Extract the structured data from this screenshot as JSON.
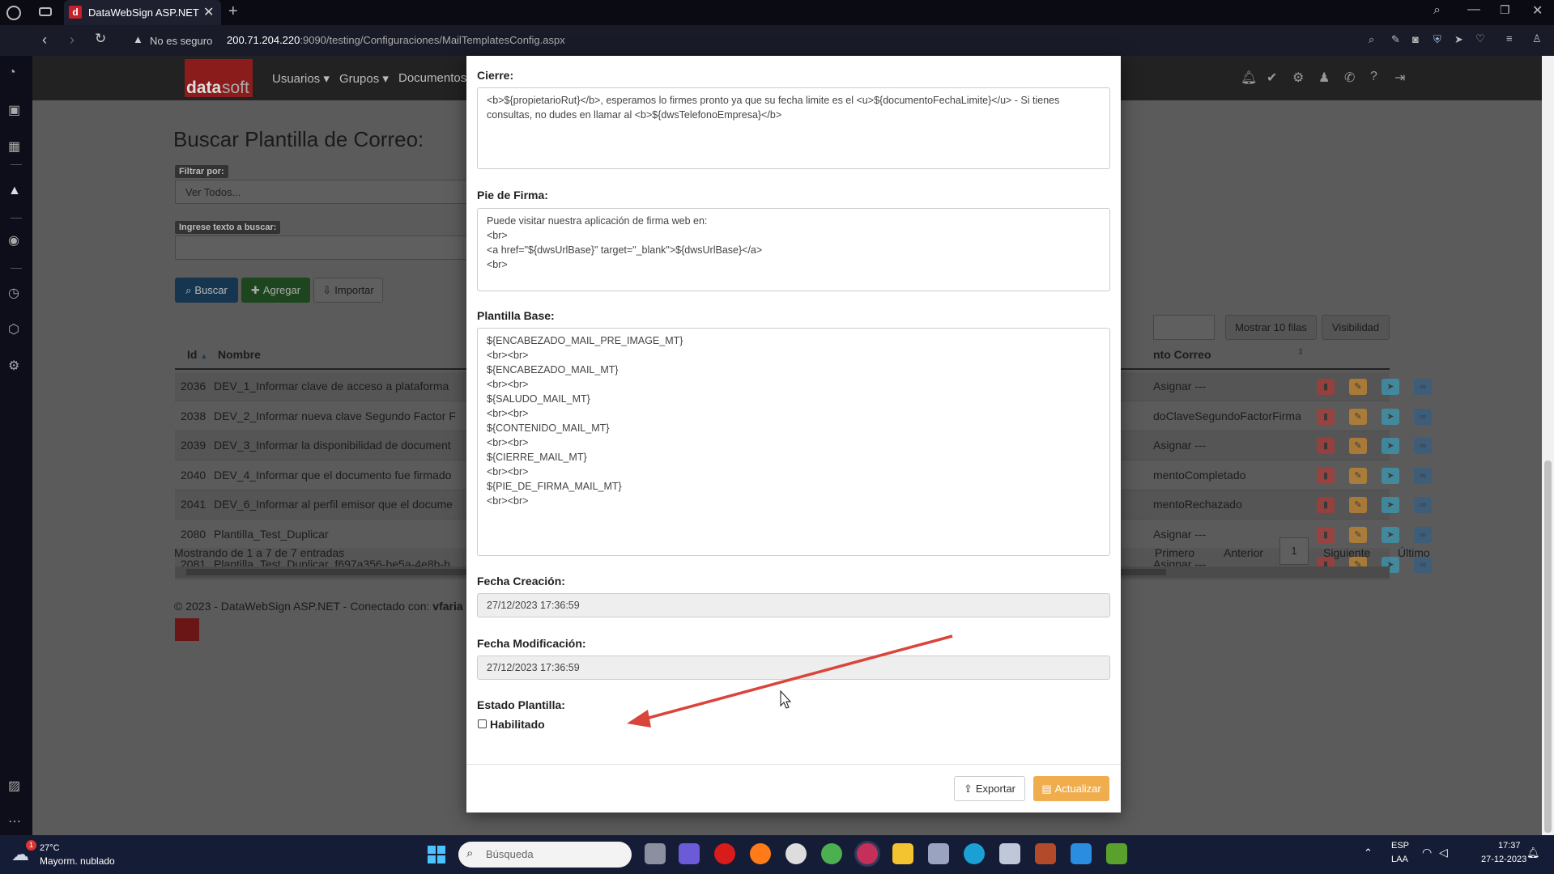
{
  "browser": {
    "tab_title": "DataWebSign ASP.NET",
    "security_label": "No es seguro",
    "url_host": "200.71.204.220",
    "url_rest": ":9090/testing/Configuraciones/MailTemplatesConfig.aspx"
  },
  "navbar": {
    "logo_data": "data",
    "logo_soft": "soft",
    "menu": [
      "Usuarios",
      "Grupos",
      "Documentos"
    ]
  },
  "background_page": {
    "title": "Buscar Plantilla de Correo:",
    "filter_label": "Filtrar por:",
    "filter_value": "Ver Todos...",
    "search_label": "Ingrese texto a buscar:",
    "buttons": {
      "buscar": "Buscar",
      "agregar": "Agregar",
      "importar": "Importar"
    },
    "table_buttons": {
      "rows": "Mostrar 10 filas",
      "visibility": "Visibilidad"
    },
    "columns": {
      "id": "Id",
      "name": "Nombre",
      "event": "nto Correo"
    },
    "rows": [
      {
        "id": "2036",
        "name": "DEV_1_Informar clave de acceso a plataforma",
        "event": "Asignar ---"
      },
      {
        "id": "2038",
        "name": "DEV_2_Informar nueva clave Segundo Factor F",
        "event": "doClaveSegundoFactorFirma"
      },
      {
        "id": "2039",
        "name": "DEV_3_Informar la disponibilidad de document",
        "event": "Asignar ---"
      },
      {
        "id": "2040",
        "name": "DEV_4_Informar que el documento fue firmado",
        "event": "mentoCompletado"
      },
      {
        "id": "2041",
        "name": "DEV_6_Informar al perfil emisor que el docume",
        "event": "mentoRechazado"
      },
      {
        "id": "2080",
        "name": "Plantilla_Test_Duplicar",
        "event": "Asignar ---"
      },
      {
        "id": "2081",
        "name": "Plantilla_Test_Duplicar_f697a356-be5a-4e8b-b",
        "event": "Asignar ---"
      }
    ],
    "info": "Mostrando de 1 a 7 de 7 entradas",
    "pager": {
      "first": "Primero",
      "prev": "Anterior",
      "page": "1",
      "next": "Siguiente",
      "last": "Último"
    },
    "footer": "© 2023 - DataWebSign ASP.NET - Conectado con:",
    "footer_user": "vfaria"
  },
  "modal": {
    "cierre_label": "Cierre:",
    "cierre_value": "<b>${propietarioRut}</b>, esperamos lo firmes pronto ya que su fecha limite es el <u>${documentoFechaLimite}</u> - Si tienes consultas, no dudes en llamar al <b>${dwsTelefonoEmpresa}</b>",
    "pie_label": "Pie de Firma:",
    "pie_value": "Puede visitar nuestra aplicación de firma web en:\n<br>\n<a href=\"${dwsUrlBase}\" target=\"_blank\">${dwsUrlBase}</a>\n<br>",
    "base_label": "Plantilla Base:",
    "base_value": "${ENCABEZADO_MAIL_PRE_IMAGE_MT}\n<br><br>\n${ENCABEZADO_MAIL_MT}\n<br><br>\n${SALUDO_MAIL_MT}\n<br><br>\n${CONTENIDO_MAIL_MT}\n<br><br>\n${CIERRE_MAIL_MT}\n<br><br>\n${PIE_DE_FIRMA_MAIL_MT}\n<br><br>",
    "creacion_label": "Fecha Creación:",
    "creacion_value": "27/12/2023 17:36:59",
    "modificacion_label": "Fecha Modificación:",
    "modificacion_value": "27/12/2023 17:36:59",
    "estado_label": "Estado Plantilla:",
    "habilitado_label": "Habilitado",
    "habilitado_checked": false,
    "exportar": "Exportar",
    "actualizar": "Actualizar"
  },
  "taskbar": {
    "weather_temp": "27°C",
    "weather_desc": "Mayorm. nublado",
    "weather_badge": "1",
    "search_placeholder": "Búsqueda",
    "lang_1": "ESP",
    "lang_2": "LAA",
    "time": "17:37",
    "date": "27-12-2023"
  },
  "colors": {
    "accent_red": "#d9453b",
    "btn_blue": "#2d6ca2",
    "btn_green": "#3c8d3c",
    "btn_orange": "#f0ad4e",
    "delete": "#c9302c",
    "edit": "#ec971f",
    "send": "#31b0d5",
    "link": "#286090"
  }
}
